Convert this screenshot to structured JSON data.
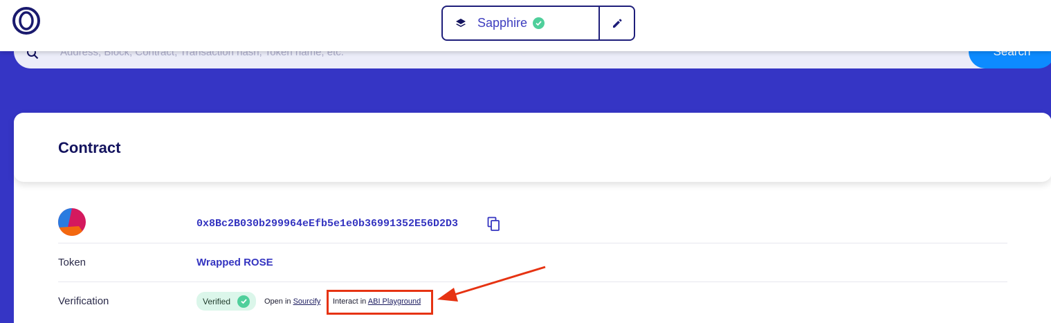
{
  "header": {
    "network": {
      "name": "Sapphire"
    }
  },
  "search": {
    "placeholder": "Address, Block, Contract, Transaction hash, Token name, etc.",
    "button_label": "Search"
  },
  "contract": {
    "title": "Contract",
    "address": "0x8Bc2B030b299964eEfb5e1e0b36991352E56D2D3",
    "token_label": "Token",
    "token_name": "Wrapped ROSE",
    "verification_label": "Verification",
    "verified_text": "Verified",
    "open_in_prefix": "Open in ",
    "sourcify_link": "Sourcify",
    "interact_prefix": "Interact in ",
    "abi_link": "ABI Playground"
  },
  "colors": {
    "accent": "#3535c5",
    "link": "#3434c0",
    "verified_bg": "#dbf6ea",
    "verified_check": "#4fcf9b",
    "annotation": "#e63312"
  }
}
